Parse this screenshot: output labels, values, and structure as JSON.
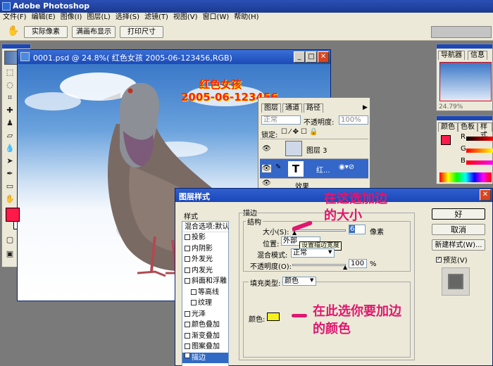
{
  "app": {
    "title": "Adobe Photoshop"
  },
  "menu": [
    "文件(F)",
    "编辑(E)",
    "图像(I)",
    "图层(L)",
    "选择(S)",
    "滤镜(T)",
    "视图(V)",
    "窗口(W)",
    "帮助(H)"
  ],
  "options": {
    "actual_pixels": "实际像素",
    "fit_screen": "满画布显示",
    "print_size": "打印尺寸"
  },
  "document": {
    "title": "0001.psd @ 24.8%(   红色女孩 2005-06-123456,RGB)",
    "text_line1": "红色女孩",
    "text_line2": "2005-06-123456"
  },
  "layers_panel": {
    "tabs": [
      "图层",
      "通道",
      "路径"
    ],
    "blend_mode": "正常",
    "opacity_label": "不透明度:",
    "opacity_value": "100%",
    "lock_label": "锁定:",
    "layers": [
      {
        "name": "图层 3"
      },
      {
        "name": "红..."
      }
    ],
    "effects_label": "效果"
  },
  "navigator": {
    "tabs": [
      "导航器",
      "信息"
    ],
    "zoom": "24.79%"
  },
  "color_panel": {
    "tabs": [
      "颜色",
      "色板",
      "样式"
    ],
    "channels": [
      "R",
      "G",
      "B"
    ]
  },
  "dialog": {
    "title": "图层样式",
    "styles_header": "样式",
    "blend_options": "混合选项:默认",
    "style_items": [
      {
        "label": "投影",
        "checked": false,
        "indent": false
      },
      {
        "label": "内阴影",
        "checked": false,
        "indent": false
      },
      {
        "label": "外发光",
        "checked": false,
        "indent": false
      },
      {
        "label": "内发光",
        "checked": false,
        "indent": false
      },
      {
        "label": "斜面和浮雕",
        "checked": false,
        "indent": false
      },
      {
        "label": "等高线",
        "checked": false,
        "indent": true
      },
      {
        "label": "纹理",
        "checked": false,
        "indent": true
      },
      {
        "label": "光泽",
        "checked": false,
        "indent": false
      },
      {
        "label": "颜色叠加",
        "checked": false,
        "indent": false
      },
      {
        "label": "渐变叠加",
        "checked": false,
        "indent": false
      },
      {
        "label": "图案叠加",
        "checked": false,
        "indent": false
      },
      {
        "label": "描边",
        "checked": true,
        "indent": false
      }
    ],
    "stroke_title": "描边",
    "structure_label": "结构",
    "size_label": "大小(S):",
    "size_value": "6",
    "size_unit": "像素",
    "position_label": "位置:",
    "position_value": "外部",
    "tooltip": "设置描边宽度",
    "blend_mode_label": "混合模式:",
    "blend_mode_value": "正常",
    "opacity_label": "不透明度(O):",
    "opacity_value": "100",
    "opacity_unit": "%",
    "fill_type_label": "填充类型:",
    "fill_type_value": "颜色",
    "color_label": "颜色:",
    "stroke_color": "#f5f020",
    "ok": "好",
    "cancel": "取消",
    "new_style": "新建样式(W)...",
    "preview": "预览(V)"
  },
  "annotations": {
    "a1_line1": "在这选加边",
    "a1_line2": "的大小",
    "a2_line1": "在此选你要加边",
    "a2_line2": "的颜色"
  },
  "colors": {
    "foreground": "#ff1a4a",
    "annotation": "#e0166f",
    "title_bar": "#1b47b8"
  }
}
